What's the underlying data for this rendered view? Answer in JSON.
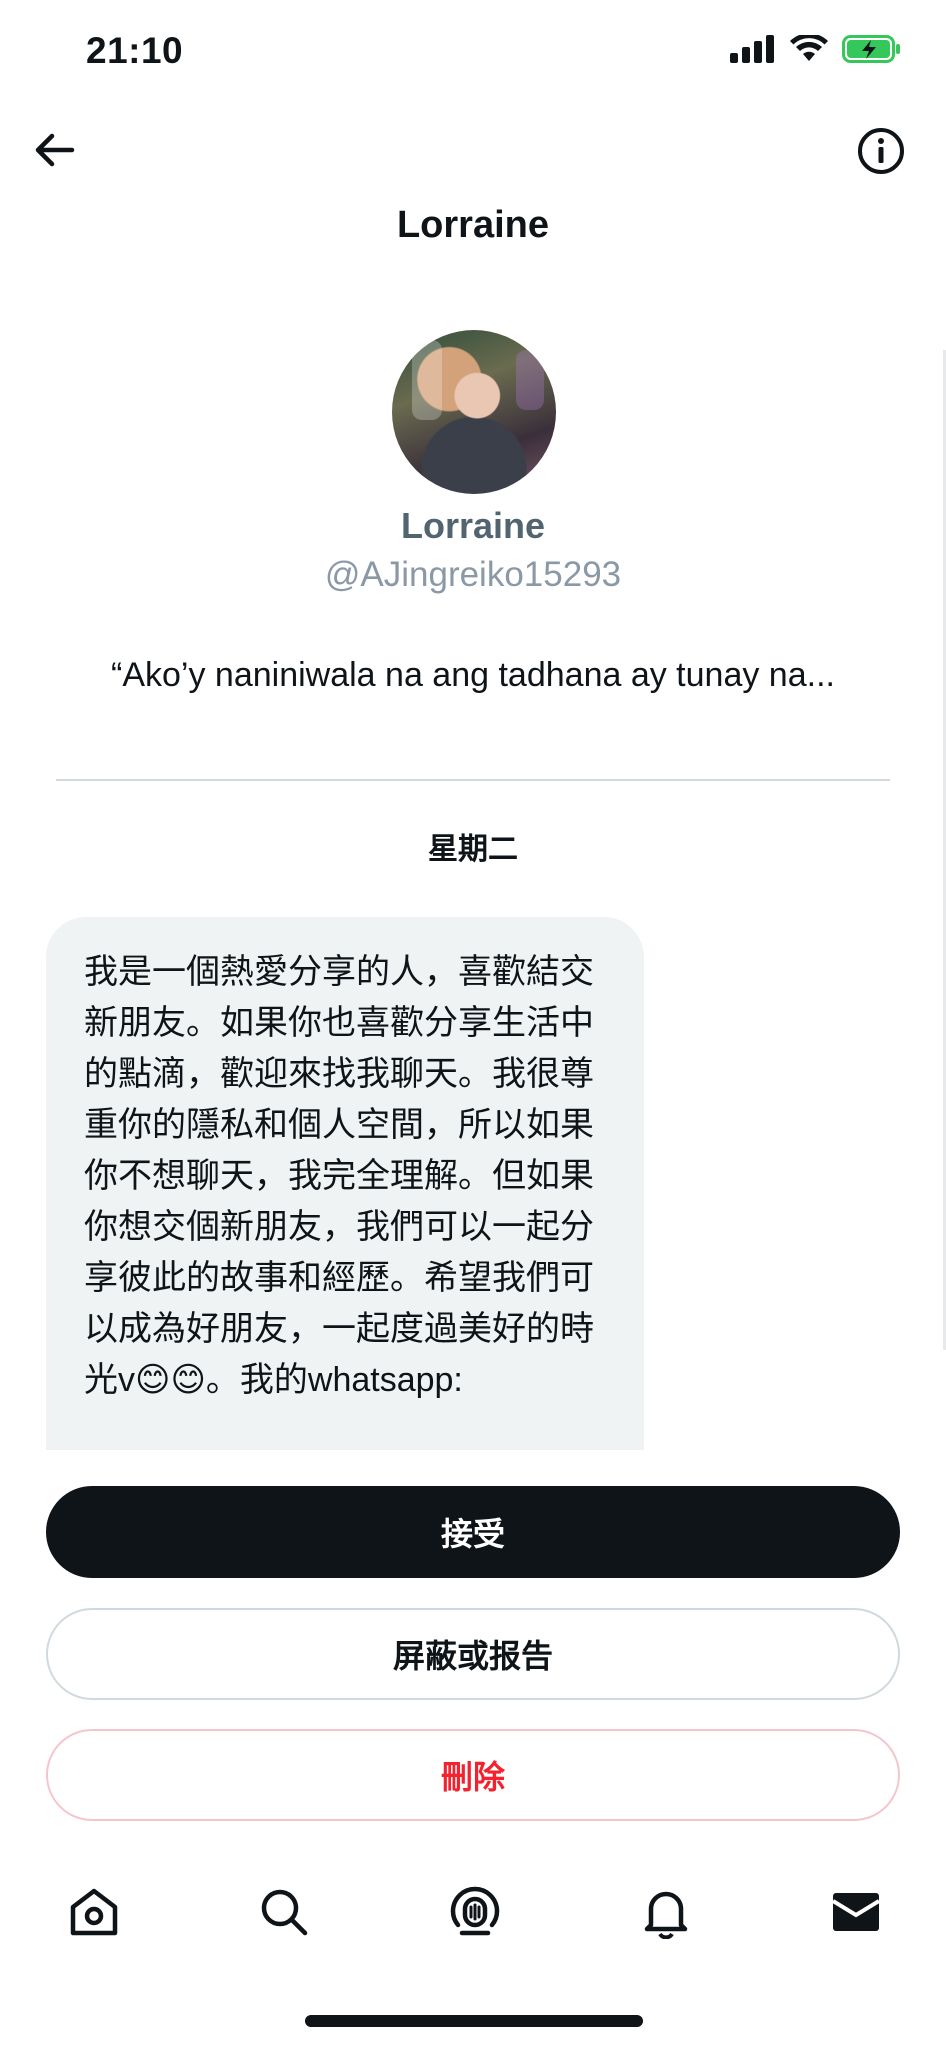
{
  "status_bar": {
    "time": "21:10"
  },
  "header": {
    "title": "Lorraine"
  },
  "profile": {
    "name": "Lorraine",
    "handle": "@AJingreiko15293",
    "bio": "“Ako’y naniniwala na ang tadhana ay tunay na..."
  },
  "conversation": {
    "date_separator": "星期二",
    "message": "我是一個熱愛分享的人，喜歡結交新朋友。如果你也喜歡分享生活中的點滴，歡迎來找我聊天。我很尊重你的隱私和個人空間，所以如果你不想聊天，我完全理解。但如果你想交個新朋友，我們可以一起分享彼此的故事和經歷。希望我們可以成為好朋友，一起度過美好的時光v😊😊。我的whatsapp:"
  },
  "actions": {
    "accept": "接受",
    "block_report": "屏蔽或报告",
    "delete": "刪除"
  },
  "tabbar": {
    "items": [
      "home-icon",
      "search-icon",
      "spaces-icon",
      "notifications-icon",
      "messages-icon"
    ]
  },
  "colors": {
    "text": "#0f1419",
    "secondary": "#536471",
    "bubble": "#eff3f4",
    "danger": "#f4212e",
    "battery": "#34c759"
  }
}
